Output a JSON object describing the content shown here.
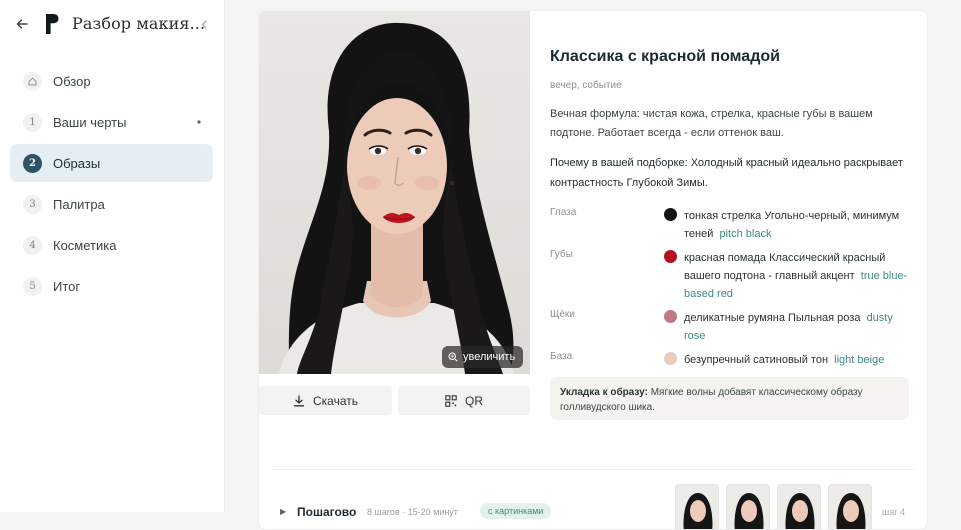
{
  "sidebar": {
    "title": "Разбор макия...",
    "items": [
      {
        "num": "",
        "label": "Обзор",
        "active": false
      },
      {
        "num": "1",
        "label": "Ваши черты",
        "active": false
      },
      {
        "num": "2",
        "label": "Образы",
        "active": true
      },
      {
        "num": "3",
        "label": "Палитра",
        "active": false
      },
      {
        "num": "4",
        "label": "Косметика",
        "active": false
      },
      {
        "num": "5",
        "label": "Итог",
        "active": false
      }
    ]
  },
  "photo": {
    "zoom_label": "увеличить",
    "download_label": "Скачать",
    "qr_label": "QR"
  },
  "look": {
    "title": "Классика с красной помадой",
    "tags": "вечер, событие",
    "description": "Вечная формула: чистая кожа, стрелка, красные губы в вашем подтоне. Работает всегда - если оттенок ваш.",
    "why": "Почему в вашей подборке: Холодный красный идеально раскрывает контрастность Глубокой Зимы.",
    "features": [
      {
        "label": "Глаза",
        "color": "#141414",
        "text": "тонкая стрелка Угольно-черный, минимум теней",
        "hex": "pitch black"
      },
      {
        "label": "Губы",
        "color": "#b5101f",
        "text": "красная помада Классический красный вашего подтона - главный акцент",
        "hex": "true blue-based red"
      },
      {
        "label": "Щёки",
        "color": "#c2787f",
        "text": "деликатные румяна Пыльная роза",
        "hex": "dusty rose"
      },
      {
        "label": "База",
        "color": "#e8ccbe",
        "text": "безупречный сатиновый тон",
        "hex": "light beige"
      }
    ],
    "tip_label": "Укладка к образу:",
    "tip_text": "Мягкие волны добавят классическому образу голливудского шика."
  },
  "steps": {
    "title": "Пошагово",
    "meta": "8 шагов · 15-20 минут",
    "badge": "с картинками",
    "count": "шаг 4"
  }
}
